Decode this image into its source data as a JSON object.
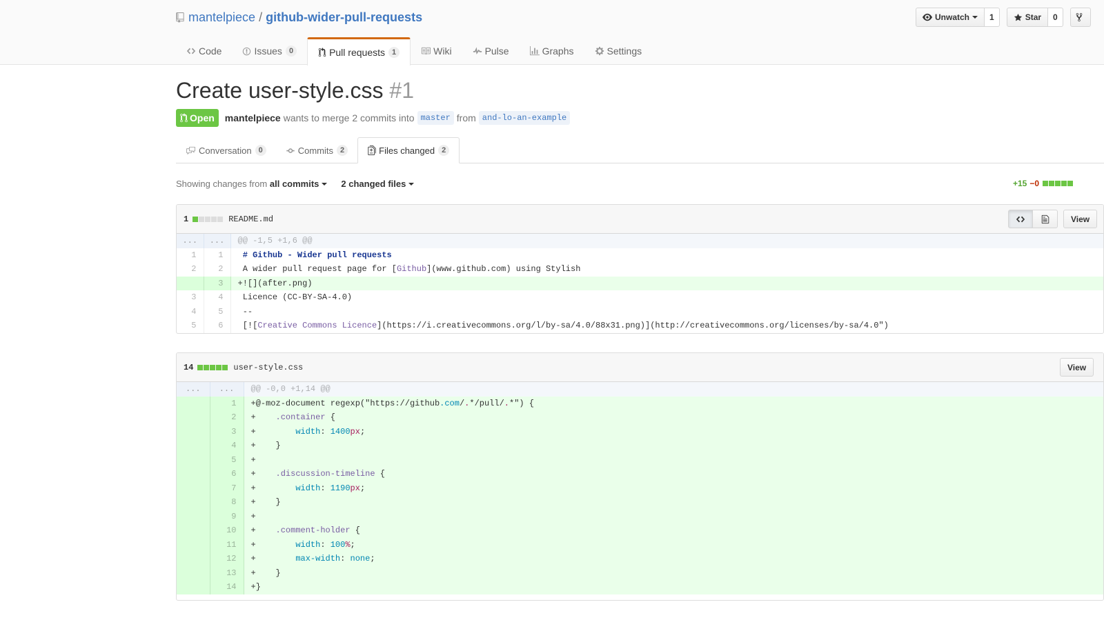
{
  "repo": {
    "owner": "mantelpiece",
    "separator": "/",
    "name": "github-wider-pull-requests"
  },
  "actions": {
    "watch_label": "Unwatch",
    "watch_count": "1",
    "star_label": "Star",
    "star_count": "0"
  },
  "reponav": [
    {
      "label": "Code",
      "icon": "code-icon"
    },
    {
      "label": "Issues",
      "icon": "issue-icon",
      "count": "0"
    },
    {
      "label": "Pull requests",
      "icon": "pull-request-icon",
      "count": "1",
      "selected": true
    },
    {
      "label": "Wiki",
      "icon": "book-icon"
    },
    {
      "label": "Pulse",
      "icon": "pulse-icon"
    },
    {
      "label": "Graphs",
      "icon": "graph-icon"
    },
    {
      "label": "Settings",
      "icon": "gear-icon"
    }
  ],
  "pr": {
    "title": "Create user-style.css",
    "number": "#1",
    "state": "Open",
    "author": "mantelpiece",
    "meta_text_1": "wants to merge 2 commits into",
    "base_ref": "master",
    "meta_text_2": "from",
    "head_ref": "and-lo-an-example"
  },
  "tabs": [
    {
      "label": "Conversation",
      "count": "0",
      "icon": "comment-discussion-icon"
    },
    {
      "label": "Commits",
      "count": "2",
      "icon": "commit-icon"
    },
    {
      "label": "Files changed",
      "count": "2",
      "icon": "diff-icon",
      "selected": true
    }
  ],
  "toolbar": {
    "showing_prefix": "Showing changes from",
    "commits_selector": "all commits",
    "files_selector": "2 changed files",
    "additions": "+15",
    "deletions": "−0"
  },
  "files": [
    {
      "count": "1",
      "name": "README.md",
      "view_label": "View",
      "hunk": "@@ -1,5 +1,6 @@",
      "lines": [
        {
          "old": "1",
          "new": "1",
          "text": " # Github - Wider pull requests",
          "type": "ctx"
        },
        {
          "old": "2",
          "new": "2",
          "text": " A wider pull request page for [Github](www.github.com) using Stylish",
          "type": "ctx"
        },
        {
          "old": "",
          "new": "3",
          "text": "+![](after.png)",
          "type": "add"
        },
        {
          "old": "3",
          "new": "4",
          "text": " Licence (CC-BY-SA-4.0)",
          "type": "ctx"
        },
        {
          "old": "4",
          "new": "5",
          "text": " --",
          "type": "ctx"
        },
        {
          "old": "5",
          "new": "6",
          "text": " [![Creative Commons Licence](https://i.creativecommons.org/l/by-sa/4.0/88x31.png)](http://creativecommons.org/licenses/by-sa/4.0\")",
          "type": "ctx"
        }
      ]
    },
    {
      "count": "14",
      "name": "user-style.css",
      "view_label": "View",
      "hunk": "@@ -0,0 +1,14 @@",
      "lines": [
        {
          "old": "",
          "new": "1",
          "text": "+@-moz-document regexp(\"https://github.com/.*/pull/.*\") {",
          "type": "add"
        },
        {
          "old": "",
          "new": "2",
          "text": "+    .container {",
          "type": "add"
        },
        {
          "old": "",
          "new": "3",
          "text": "+        width: 1400px;",
          "type": "add"
        },
        {
          "old": "",
          "new": "4",
          "text": "+    }",
          "type": "add"
        },
        {
          "old": "",
          "new": "5",
          "text": "+",
          "type": "add"
        },
        {
          "old": "",
          "new": "6",
          "text": "+    .discussion-timeline {",
          "type": "add"
        },
        {
          "old": "",
          "new": "7",
          "text": "+        width: 1190px;",
          "type": "add"
        },
        {
          "old": "",
          "new": "8",
          "text": "+    }",
          "type": "add"
        },
        {
          "old": "",
          "new": "9",
          "text": "+",
          "type": "add"
        },
        {
          "old": "",
          "new": "10",
          "text": "+    .comment-holder {",
          "type": "add"
        },
        {
          "old": "",
          "new": "11",
          "text": "+        width: 100%;",
          "type": "add"
        },
        {
          "old": "",
          "new": "12",
          "text": "+        max-width: none;",
          "type": "add"
        },
        {
          "old": "",
          "new": "13",
          "text": "+    }",
          "type": "add"
        },
        {
          "old": "",
          "new": "14",
          "text": "+}",
          "type": "add"
        }
      ]
    }
  ],
  "colors": {
    "accent": "#4078c0",
    "open_green": "#6cc644",
    "selected_tab": "#d26911",
    "add_bg": "#eaffea"
  }
}
